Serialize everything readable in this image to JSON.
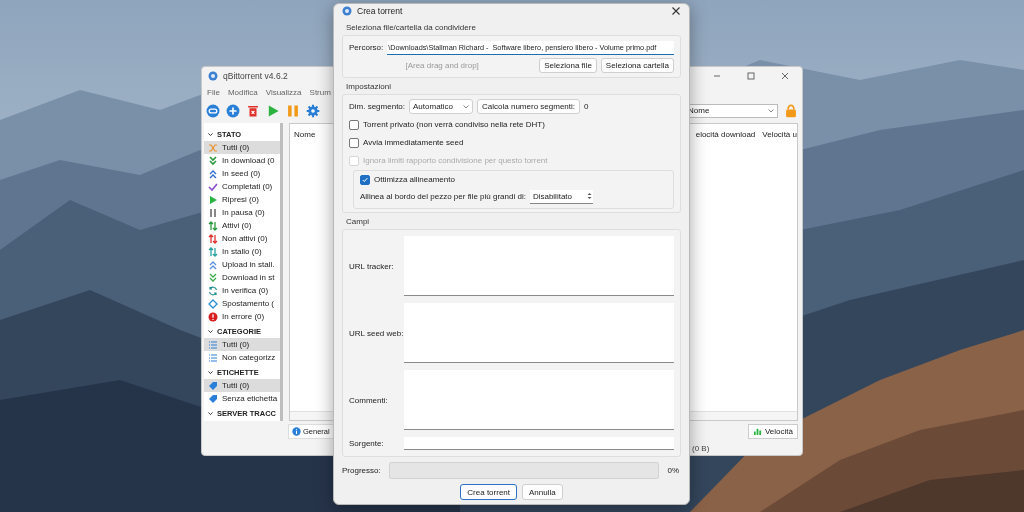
{
  "main_window": {
    "title": "qBittorrent v4.6.2",
    "menu": [
      "File",
      "Modifica",
      "Visualizza",
      "Strum"
    ],
    "filter_select": {
      "value": "Nome"
    },
    "sidebar": [
      {
        "title": "STATO",
        "expanded": true,
        "items": [
          {
            "label": "Tutti (0)",
            "selected": true
          },
          {
            "label": "In download (0",
            "selected": false
          },
          {
            "label": "In seed (0)",
            "selected": false
          },
          {
            "label": "Completati (0)",
            "selected": false
          },
          {
            "label": "Ripresi (0)",
            "selected": false
          },
          {
            "label": "In pausa (0)",
            "selected": false
          },
          {
            "label": "Attivi (0)",
            "selected": false
          },
          {
            "label": "Non attivi (0)",
            "selected": false
          },
          {
            "label": "In stallo (0)",
            "selected": false
          },
          {
            "label": "Upload in stall.",
            "selected": false
          },
          {
            "label": "Download in st",
            "selected": false
          },
          {
            "label": "In verifica (0)",
            "selected": false
          },
          {
            "label": "Spostamento (",
            "selected": false
          },
          {
            "label": "In errore (0)",
            "selected": false
          }
        ]
      },
      {
        "title": "CATEGORIE",
        "expanded": true,
        "items": [
          {
            "label": "Tutti (0)",
            "selected": true
          },
          {
            "label": "Non categorizz",
            "selected": false
          }
        ]
      },
      {
        "title": "ETICHETTE",
        "expanded": true,
        "items": [
          {
            "label": "Tutti (0)",
            "selected": true
          },
          {
            "label": "Senza etichetta",
            "selected": false
          }
        ]
      },
      {
        "title": "SERVER TRACC",
        "expanded": true
      }
    ],
    "table": {
      "columns": [
        "Nome",
        "elocità download",
        "Velocità u"
      ]
    },
    "bottom_tab": "General",
    "speed_button": "Velocità",
    "status_bar": "(0 B)"
  },
  "dialog": {
    "title": "Crea torrent",
    "source": {
      "title": "Seleziona file/cartella da condividere",
      "path_label": "Percorso:",
      "path_value": "\\Downloads\\Stallman Richard -  Software libero, pensiero libero - Volume primo.pdf",
      "path_focused": true,
      "drop_hint": "[Area drag and drop]",
      "buttons": [
        "Seleziona file",
        "Seleziona cartella"
      ]
    },
    "settings": {
      "title": "Impostazioni",
      "piece_size_label": "Dim. segmento:",
      "piece_size_value": "Automatico",
      "calc_button": "Calcola numero segmenti:",
      "piece_count": "0",
      "options": [
        {
          "label": "Torrent privato (non verrà condiviso nella rete DHT)",
          "checked": false,
          "disabled": false
        },
        {
          "label": "Avvia immediatamente seed",
          "checked": false,
          "disabled": false
        },
        {
          "label": "Ignora limiti rapporto condivisione per questo torrent",
          "checked": false,
          "disabled": true
        }
      ],
      "alignment": {
        "label": "Ottimizza allineamento",
        "checked": true,
        "threshold_label": "Allinea al bordo del pezzo per file più grandi di:",
        "threshold_value": "Disabilitato"
      }
    },
    "fields": {
      "title": "Campi",
      "items": [
        {
          "kind": "area",
          "label": "URL tracker:"
        },
        {
          "kind": "area",
          "label": "URL seed web:"
        },
        {
          "kind": "area",
          "label": "Commenti:"
        },
        {
          "kind": "line",
          "label": "Sorgente:"
        }
      ]
    },
    "progress": {
      "label": "Progresso:",
      "level": 0,
      "reading": "0%"
    },
    "buttons": [
      {
        "label": "Crea torrent",
        "focused": true
      },
      {
        "label": "Annulla",
        "focused": false
      }
    ]
  }
}
